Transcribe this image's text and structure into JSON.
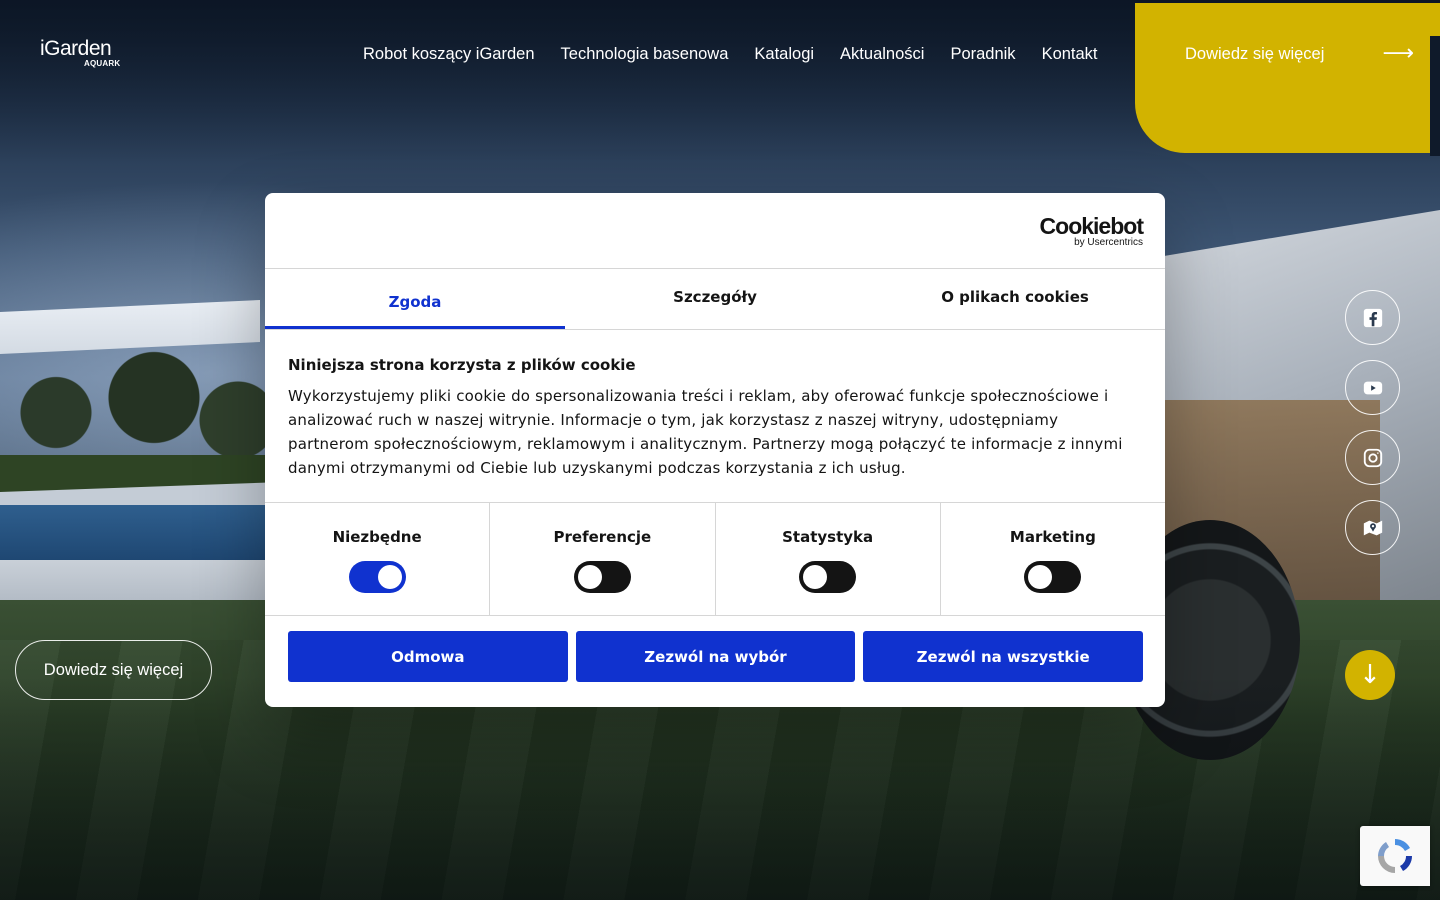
{
  "header": {
    "logo_text": "iGarden",
    "logo_sub": "AQUARK",
    "nav": [
      {
        "label": "Robot koszący iGarden"
      },
      {
        "label": "Technologia basenowa"
      },
      {
        "label": "Katalogi"
      },
      {
        "label": "Aktualności"
      },
      {
        "label": "Poradnik"
      },
      {
        "label": "Kontakt"
      }
    ],
    "cta_label": "Dowiedz się więcej",
    "cta_arrow": "⟶"
  },
  "hero": {
    "more_label": "Dowiedz się więcej",
    "scroll_arrow": "↓"
  },
  "social": [
    "facebook-icon",
    "youtube-icon",
    "instagram-icon",
    "map-icon"
  ],
  "cookie": {
    "brand": "Cookiebot",
    "brand_sub": "by Usercentrics",
    "tabs": [
      {
        "label": "Zgoda",
        "active": true
      },
      {
        "label": "Szczegóły",
        "active": false
      },
      {
        "label": "O plikach cookies",
        "active": false
      }
    ],
    "title": "Niniejsza strona korzysta z plików cookie",
    "text": "Wykorzystujemy pliki cookie do spersonalizowania treści i reklam, aby oferować funkcje społecznościowe i analizować ruch w naszej witrynie. Informacje o tym, jak korzystasz z naszej witryny, udostępniamy partnerom społecznościowym, reklamowym i analitycznym. Partnerzy mogą połączyć te informacje z innymi danymi otrzymanymi od Ciebie lub uzyskanymi podczas korzystania z ich usług.",
    "categories": [
      {
        "label": "Niezbędne",
        "checked": true
      },
      {
        "label": "Preferencje",
        "checked": false
      },
      {
        "label": "Statystyka",
        "checked": false
      },
      {
        "label": "Marketing",
        "checked": false
      }
    ],
    "buttons": {
      "deny": "Odmowa",
      "allow_selection": "Zezwól na wybór",
      "allow_all": "Zezwól na wszystkie"
    }
  },
  "colors": {
    "accent_yellow": "#d2b300",
    "cookiebot_blue": "#1032cf"
  }
}
